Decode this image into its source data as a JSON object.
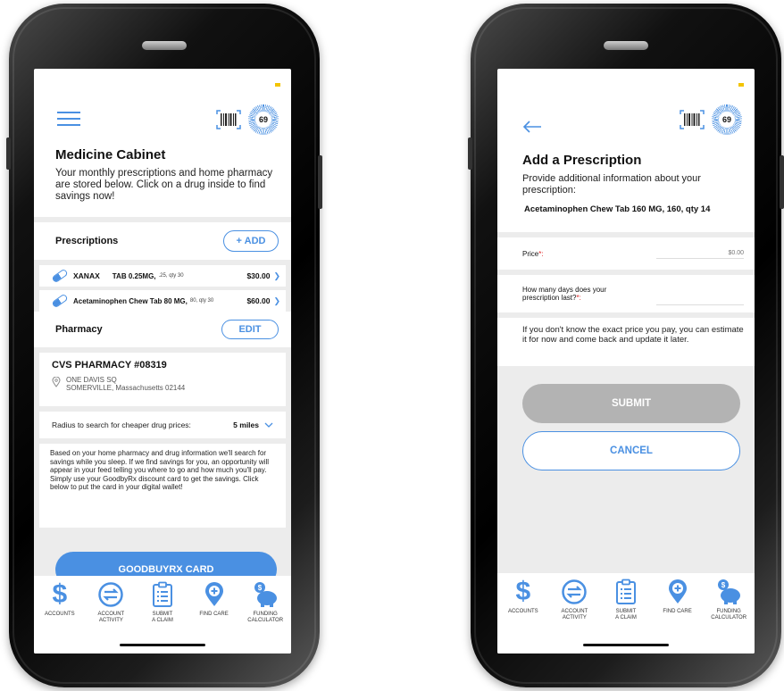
{
  "left": {
    "score": "69",
    "title": "Medicine Cabinet",
    "intro": "Your monthly prescriptions and home pharmacy are stored below. Click on a drug inside to find savings now!",
    "prescriptions_label": "Prescriptions",
    "add_label": "+ ADD",
    "rx": [
      {
        "name": "XANAX",
        "detail_bold": "TAB 0.25MG,",
        "detail_small": ".25, qty 30",
        "price": "$30.00"
      },
      {
        "name": "Acetaminophen Chew Tab 80 MG,",
        "detail_bold": "",
        "detail_small": "80, qty 30",
        "price": "$60.00"
      }
    ],
    "pharmacy_label": "Pharmacy",
    "edit_label": "EDIT",
    "pharmacy_name": "CVS PHARMACY #08319",
    "address_line1": "ONE DAVIS SQ",
    "address_line2": "SOMERVILLE, Massachusetts 02144",
    "radius_label": "Radius to search for cheaper drug prices:",
    "radius_value": "5 miles",
    "info_text": "Based on your home pharmacy and drug information we'll search for savings while you sleep. If we find savings for you, an opportunity will appear in your feed telling you where to go and how much you'll pay. Simply use your GoodbyRx discount card to get the savings. Click below to put the card in your digital wallet!",
    "card_button": "GOODBUYRX CARD"
  },
  "right": {
    "score": "69",
    "title": "Add a Prescription",
    "intro": "Provide additional information about your prescription:",
    "drug": "Acetaminophen Chew Tab 160 MG, 160, qty 14",
    "price_label": "Price",
    "price_required": "*:",
    "price_placeholder": "$0.00",
    "days_label_1": "How many days does your",
    "days_label_2": "prescription last?",
    "days_required": "*:",
    "note": "If you don't know the exact price you pay, you can estimate it for now and come back and update it later.",
    "submit": "SUBMIT",
    "cancel": "CANCEL"
  },
  "nav": [
    {
      "label_1": "ACCOUNTS",
      "label_2": "",
      "icon": "dollar-icon"
    },
    {
      "label_1": "ACCOUNT",
      "label_2": "ACTIVITY",
      "icon": "transfer-icon"
    },
    {
      "label_1": "SUBMIT",
      "label_2": "A CLAIM",
      "icon": "clipboard-icon"
    },
    {
      "label_1": "FIND CARE",
      "label_2": "",
      "icon": "location-plus-icon"
    },
    {
      "label_1": "FUNDING",
      "label_2": "CALCULATOR",
      "icon": "piggy-bank-icon"
    }
  ],
  "colors": {
    "accent": "#4a90e2",
    "gray_bg": "#ececec",
    "disabled_btn": "#b3b3b3",
    "required": "#e02020"
  }
}
